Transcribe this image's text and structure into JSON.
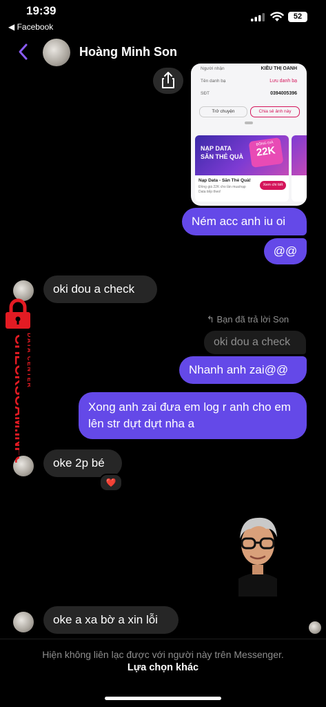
{
  "status_bar": {
    "time": "19:39",
    "back_app": "◀ Facebook",
    "battery": "52"
  },
  "header": {
    "contact_name": "Hoàng Minh Son"
  },
  "shared_card": {
    "rows": [
      {
        "label": "Người nhận",
        "value": "KIỀU THỊ OANH"
      },
      {
        "label": "Tên danh bạ",
        "value": "Lưu danh bạ"
      },
      {
        "label": "SĐT",
        "value": "0394005396"
      }
    ],
    "btn_back": "Trở chuyện",
    "btn_share": "Chia sẻ ảnh này",
    "promo_title_line1": "NẠP DATA",
    "promo_title_line2": "SĂN THẺ QUÀ",
    "promo_badge_top": "ĐỒNG GIÁ",
    "promo_badge_value": "22K",
    "promo_name": "Nạp Data - Săn Thẻ Quà!",
    "promo_desc": "Đồng giá 22K cho lần mua/nạp Data tiếp theo!",
    "promo_cta": "Xem chi tiết"
  },
  "messages": [
    {
      "from": "me",
      "text": "Ném acc anh iu oi"
    },
    {
      "from": "me",
      "text": "@@"
    },
    {
      "from": "them",
      "text": "oki dou a check"
    },
    {
      "from": "me",
      "text": "Nhanh anh zai@@"
    },
    {
      "from": "me",
      "text": "Xong anh zai đưa em log r anh cho em lên str dựt dựt nha a"
    },
    {
      "from": "them",
      "text": "oke 2p bé"
    },
    {
      "from": "them",
      "text": "oke a xa bờ a xin lỗi"
    }
  ],
  "reply_meta": {
    "note": "Bạn đã trả lời Son",
    "quoted_text": "oki dou a check"
  },
  "reaction": "❤️",
  "watermark": {
    "brand": "CHECKSCAM.INFO",
    "sub": "DATA CENTER",
    "brand_color": "#e31b23"
  },
  "footer": {
    "note": "Hiện không liên lạc được với người này trên Messenger.",
    "link": "Lựa chọn khác"
  },
  "colors": {
    "outgoing_bubble": "#6449e8",
    "incoming_bubble": "#262626",
    "accent": "#8a5cf6"
  }
}
